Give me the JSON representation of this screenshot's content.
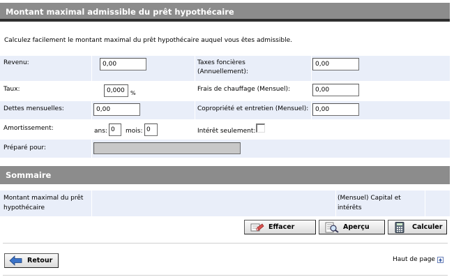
{
  "header": {
    "title": "Montant maximal admissible du prêt hypothécaire"
  },
  "intro": "Calculez facilement le montant maximal du prêt hypothécaire auquel vous êtes admissible.",
  "form": {
    "revenu_label": "Revenu:",
    "revenu_value": "0,00",
    "taxes_label_1": "Taxes foncières",
    "taxes_label_2": "(Annuellement):",
    "taxes_value": "0,00",
    "taux_label": "Taux:",
    "taux_value": "0,000",
    "taux_unit": "%",
    "frais_label": "Frais de chauffage (Mensuel):",
    "frais_value": "0,00",
    "dettes_label": "Dettes mensuelles:",
    "dettes_value": "0,00",
    "copro_label": "Copropriété et entretien (Mensuel):",
    "copro_value": "0,00",
    "amort_label": "Amortissement:",
    "ans_label": "ans:",
    "ans_value": "0",
    "mois_label": "mois:",
    "mois_value": "0",
    "interet_label": "Intérêt seulement:",
    "prepare_label": "Préparé pour:",
    "prepare_value": ""
  },
  "summary": {
    "title": "Sommaire",
    "montant_label_1": "Montant maximal du prêt",
    "montant_label_2": "hypothécaire",
    "capital_label_1": "(Mensuel) Capital et",
    "capital_label_2": "intérêts"
  },
  "buttons": {
    "effacer": "Effacer",
    "apercu": "Aperçu",
    "calculer": "Calculer",
    "retour": "Retour"
  },
  "footer": {
    "top_link": "Haut de page"
  }
}
